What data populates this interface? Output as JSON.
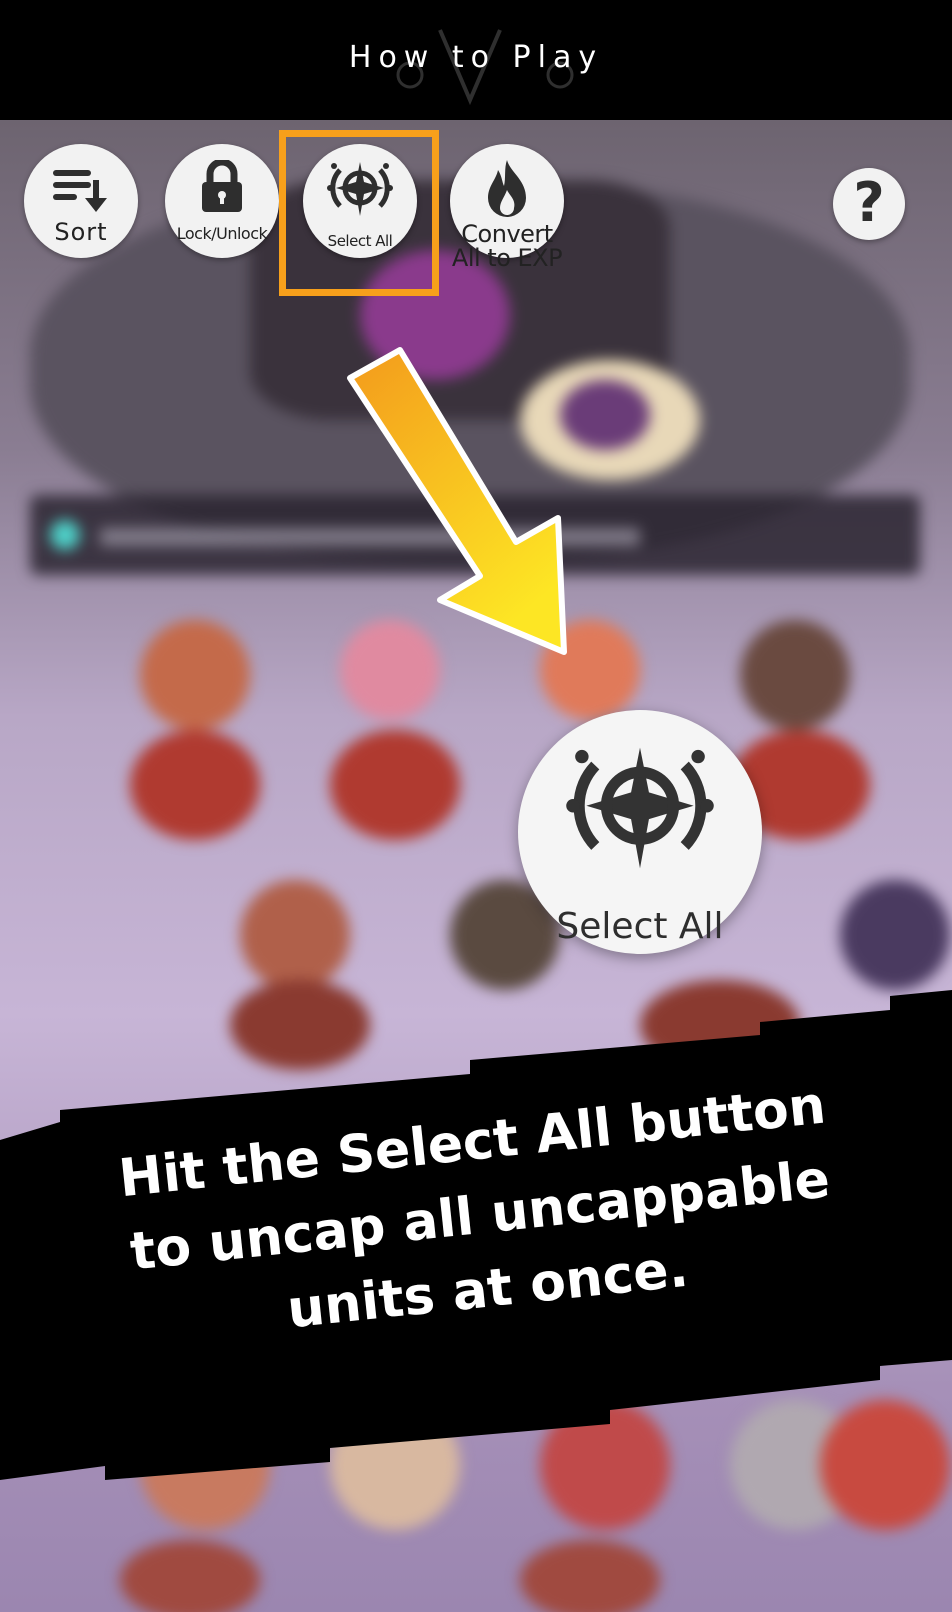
{
  "header": {
    "title": "How to Play"
  },
  "toolbar": {
    "sort_label": "Sort",
    "lock_label": "Lock/Unlock",
    "select_all_label": "Select All",
    "convert_label_line1": "Convert",
    "convert_label_line2": "All to EXP",
    "help_label": "?"
  },
  "zoom_callout": {
    "label": "Select All"
  },
  "caption": {
    "line1": "Hit the Select All button",
    "line2": "to uncap all uncappable",
    "line3": "units at once."
  },
  "colors": {
    "highlight": "#f7a01b",
    "arrow_top": "#f39a1c",
    "arrow_bottom": "#fde624",
    "banner": "#000000"
  },
  "icons": [
    "sort-icon",
    "lock-icon",
    "select-all-icon",
    "flame-icon",
    "help-icon",
    "arrow-down-right-icon"
  ]
}
